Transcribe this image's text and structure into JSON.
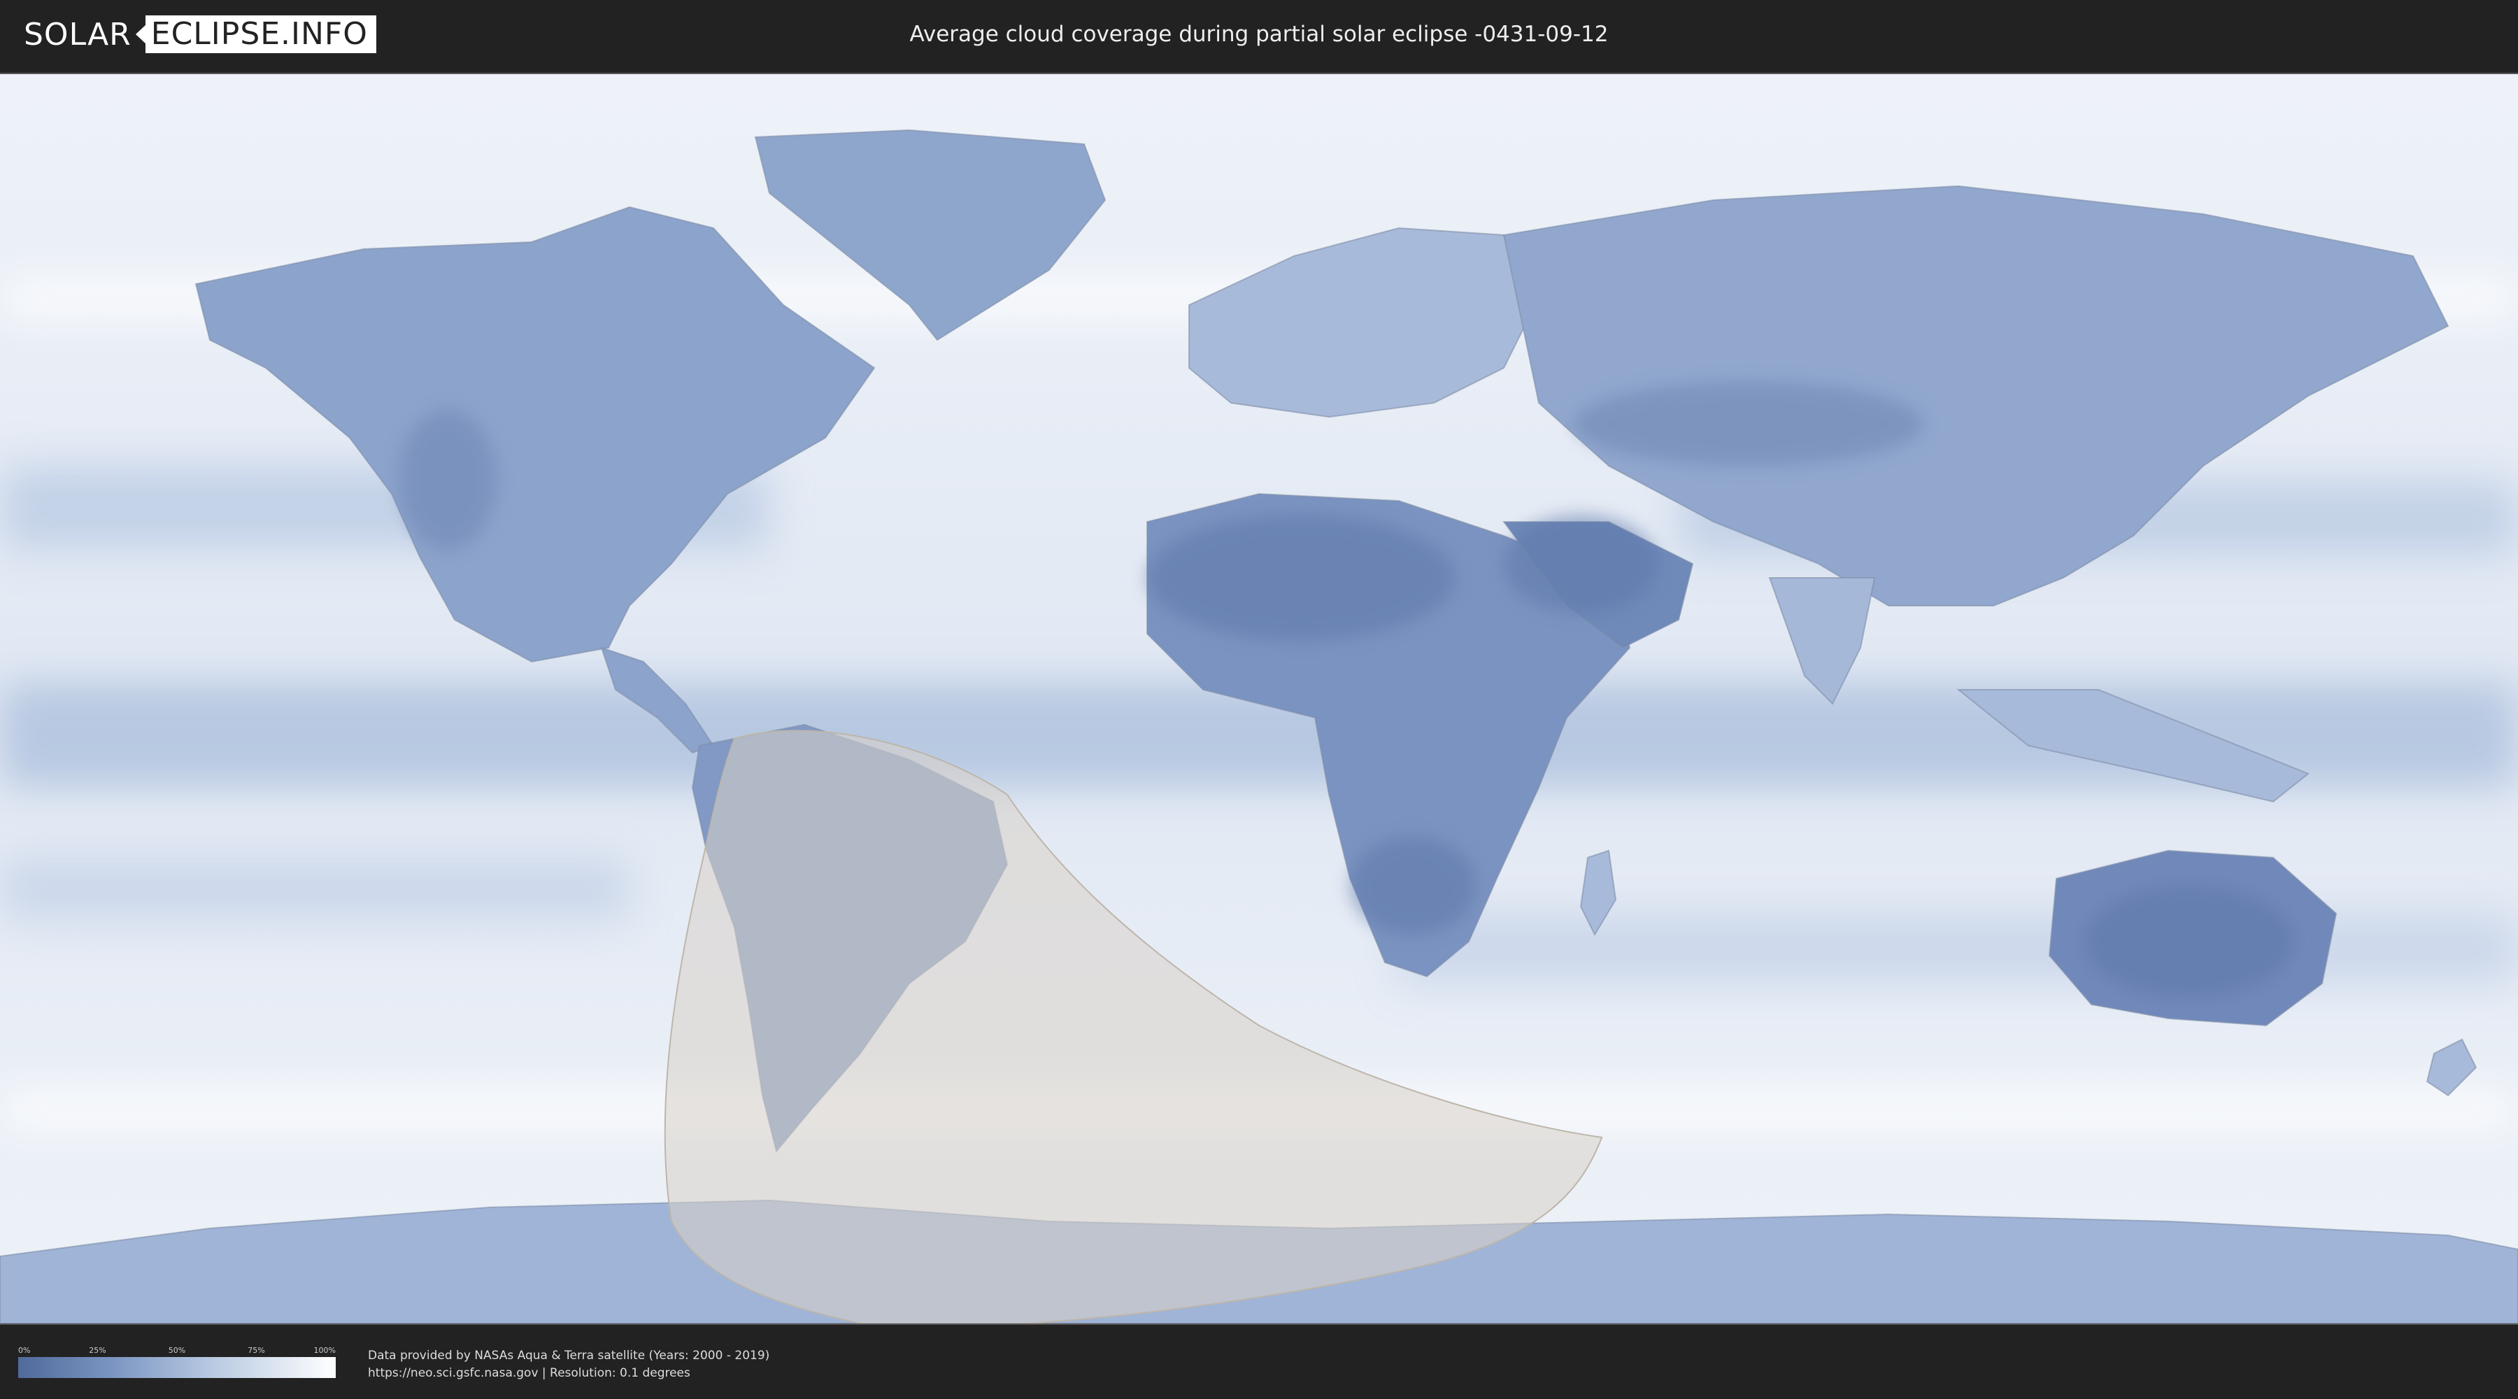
{
  "logo": {
    "part_a": "SOLAR",
    "part_b": "ECLIPSE.INFO"
  },
  "header": {
    "title": "Average cloud coverage during partial solar eclipse -0431-09-12"
  },
  "map": {
    "colors": {
      "background": "#e9eef6",
      "cloud_low": "#5a75a8",
      "cloud_mid": "#9db3d6",
      "cloud_high": "#ffffff",
      "eclipse_overlay": "#d9d4cc"
    }
  },
  "legend": {
    "ticks": [
      "0%",
      "25%",
      "50%",
      "75%",
      "100%"
    ],
    "colors": [
      "#4f6a9b",
      "#7c96c2",
      "#b6c8e1",
      "#ffffff"
    ]
  },
  "credits": {
    "line1": "Data provided by NASAs Aqua & Terra satellite (Years: 2000 - 2019)",
    "line2": "https://neo.sci.gsfc.nasa.gov | Resolution: 0.1 degrees"
  }
}
